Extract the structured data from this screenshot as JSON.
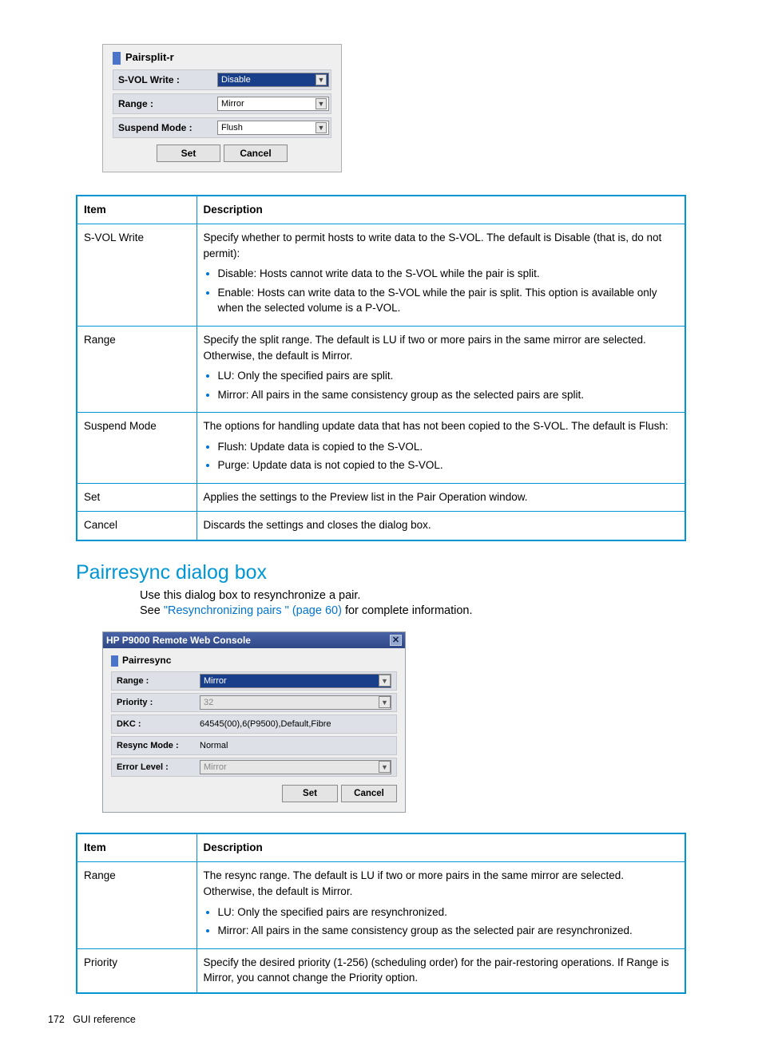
{
  "splitDialog": {
    "title": "Pairsplit-r",
    "fields": {
      "svol": {
        "label": "S-VOL Write :",
        "value": "Disable"
      },
      "range": {
        "label": "Range :",
        "value": "Mirror"
      },
      "suspend": {
        "label": "Suspend Mode :",
        "value": "Flush"
      }
    },
    "set": "Set",
    "cancel": "Cancel"
  },
  "table1": {
    "head": {
      "item": "Item",
      "desc": "Description"
    },
    "rows": [
      {
        "item": "S-VOL Write",
        "intro": "Specify whether to permit hosts to write data to the S-VOL. The default is Disable (that is, do not permit):",
        "bullets": [
          "Disable: Hosts cannot write data to the S-VOL while the pair is split.",
          "Enable: Hosts can write data to the S-VOL while the pair is split. This option is available only when the selected volume is a P-VOL."
        ]
      },
      {
        "item": "Range",
        "intro": "Specify the split range. The default is LU if two or more pairs in the same mirror are selected. Otherwise, the default is Mirror.",
        "bullets": [
          "LU: Only the specified pairs are split.",
          "Mirror: All pairs in the same consistency group as the selected pairs are split."
        ]
      },
      {
        "item": "Suspend Mode",
        "intro": "The options for handling update data that has not been copied to the S-VOL. The default is Flush:",
        "bullets": [
          "Flush: Update data is copied to the S-VOL.",
          "Purge: Update data is not copied to the S-VOL."
        ]
      },
      {
        "item": "Set",
        "intro": "Applies the settings to the Preview list in the Pair Operation window."
      },
      {
        "item": "Cancel",
        "intro": "Discards the settings and closes the dialog box."
      }
    ]
  },
  "section": {
    "heading": "Pairresync dialog box",
    "p1": "Use this dialog box to resynchronize a pair.",
    "p2a": "See ",
    "link": "\"Resynchronizing pairs \" (page 60)",
    "p2b": " for complete information."
  },
  "resyncDialog": {
    "titlebar": "HP P9000 Remote Web Console",
    "panelTitle": "Pairresync",
    "fields": {
      "range": {
        "label": "Range :",
        "value": "Mirror"
      },
      "priority": {
        "label": "Priority :",
        "value": "32"
      },
      "dkc": {
        "label": "DKC :",
        "value": "64545(00),6(P9500),Default,Fibre"
      },
      "resync": {
        "label": "Resync Mode :",
        "value": "Normal"
      },
      "error": {
        "label": "Error Level :",
        "value": "Mirror"
      }
    },
    "set": "Set",
    "cancel": "Cancel"
  },
  "table2": {
    "head": {
      "item": "Item",
      "desc": "Description"
    },
    "rows": [
      {
        "item": "Range",
        "intro": "The resync range. The default is LU if two or more pairs in the same mirror are selected. Otherwise, the default is Mirror.",
        "bullets": [
          "LU: Only the specified pairs are resynchronized.",
          "Mirror: All pairs in the same consistency group as the selected pair are resynchronized."
        ]
      },
      {
        "item": "Priority",
        "intro": "Specify the desired priority (1-256) (scheduling order) for the pair-restoring operations. If Range is Mirror, you cannot change the Priority option."
      }
    ]
  },
  "footer": {
    "pageNum": "172",
    "label": "GUI reference"
  }
}
